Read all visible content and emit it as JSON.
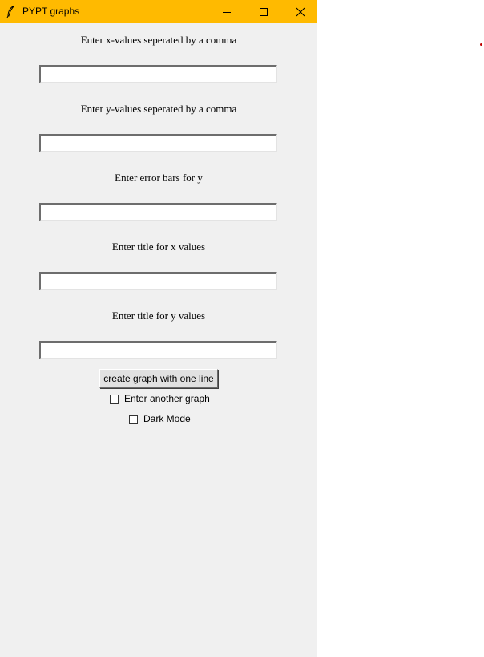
{
  "window": {
    "title": "PYPT graphs",
    "titlebar_color": "#ffba00",
    "body_color": "#f0f0f0",
    "icons": [
      "feather-icon",
      "minimize-icon",
      "maximize-icon",
      "close-icon"
    ]
  },
  "form": {
    "fields": [
      {
        "label": "Enter x-values seperated by a comma",
        "value": ""
      },
      {
        "label": "Enter y-values seperated by a comma",
        "value": ""
      },
      {
        "label": "Enter error bars for y",
        "value": ""
      },
      {
        "label": "Enter title for x values",
        "value": ""
      },
      {
        "label": "Enter title for y values",
        "value": ""
      }
    ],
    "create_button_label": "create graph with one line",
    "checkboxes": [
      {
        "label": "Enter another graph",
        "checked": false
      },
      {
        "label": "Dark Mode",
        "checked": false
      }
    ]
  }
}
